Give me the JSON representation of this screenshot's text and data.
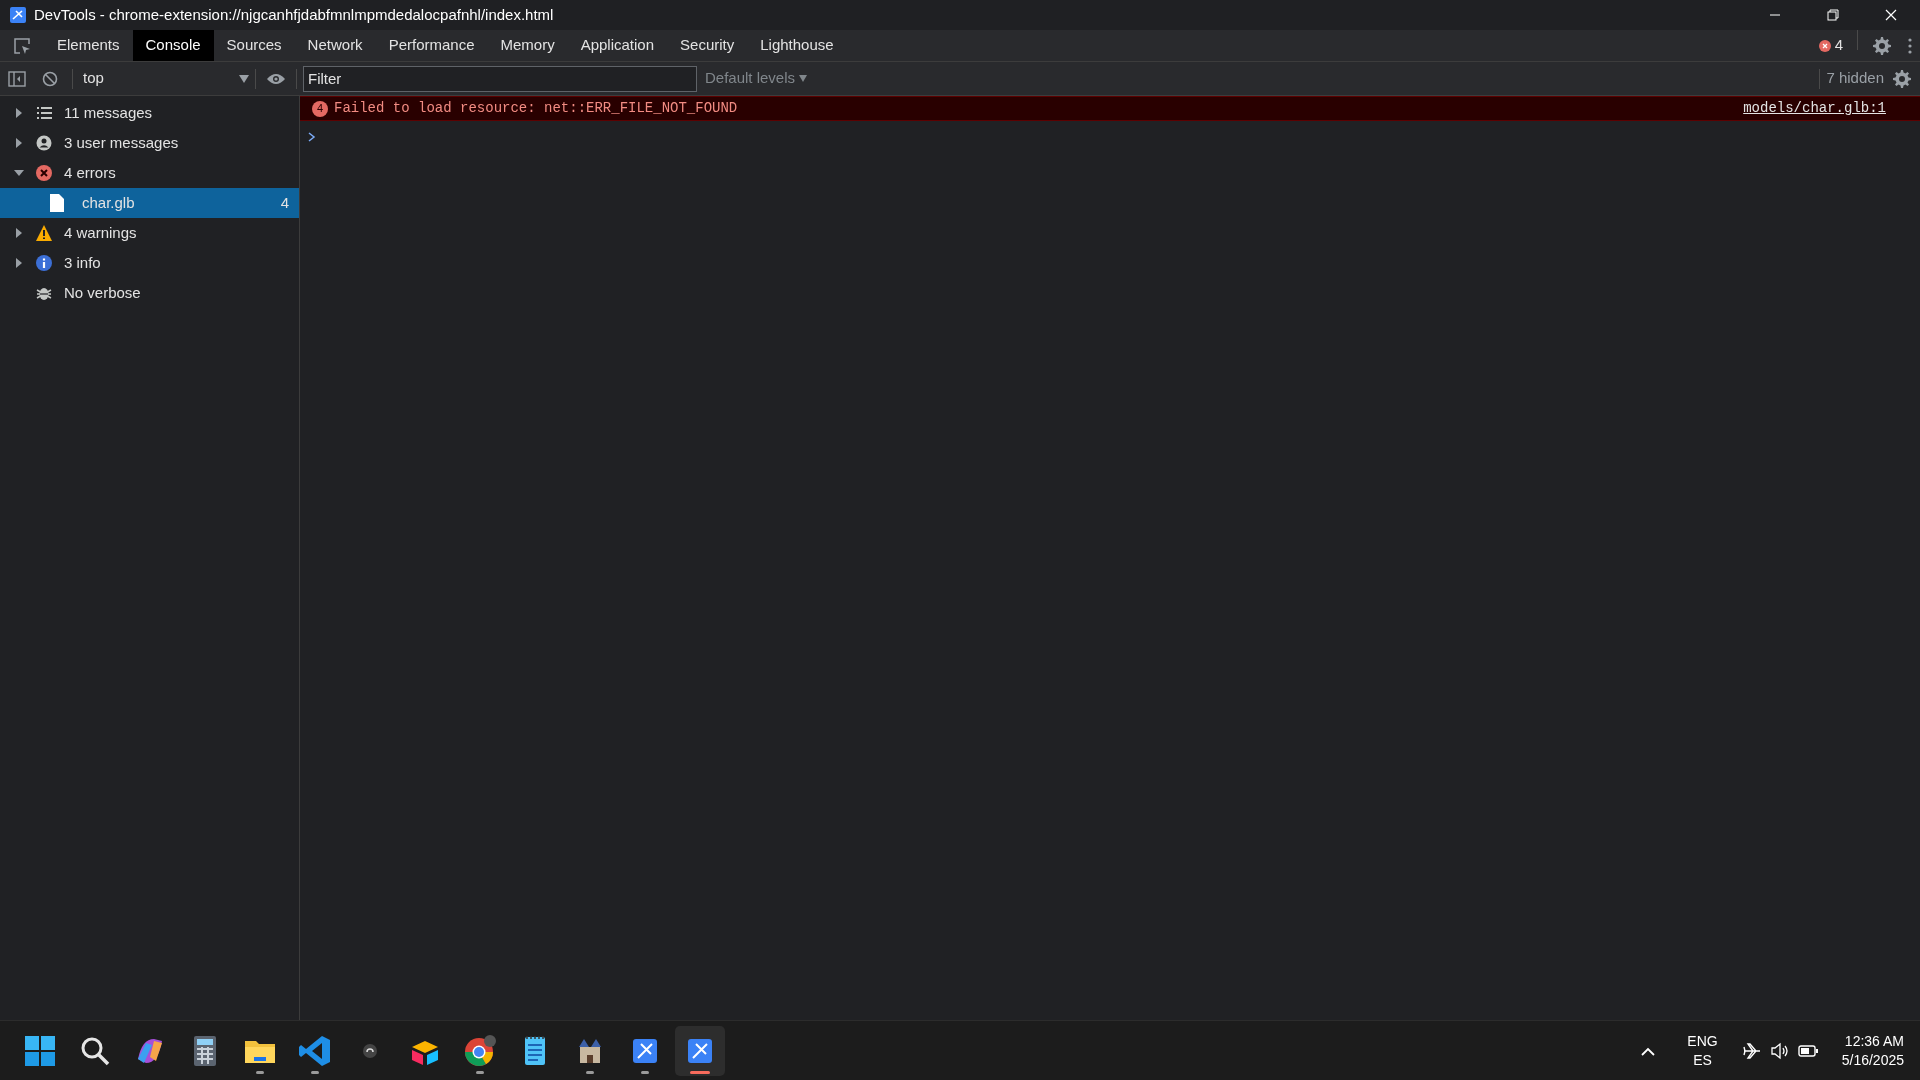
{
  "window": {
    "title": "DevTools - chrome-extension://njgcanhfjdabfmnlmpmdedalocpafnhl/index.html"
  },
  "tabs": [
    {
      "label": "Elements",
      "selected": false
    },
    {
      "label": "Console",
      "selected": true
    },
    {
      "label": "Sources",
      "selected": false
    },
    {
      "label": "Network",
      "selected": false
    },
    {
      "label": "Performance",
      "selected": false
    },
    {
      "label": "Memory",
      "selected": false
    },
    {
      "label": "Application",
      "selected": false
    },
    {
      "label": "Security",
      "selected": false
    },
    {
      "label": "Lighthouse",
      "selected": false
    }
  ],
  "error_count": "4",
  "toolbar": {
    "context": "top",
    "filter": {
      "placeholder": "Filter"
    },
    "levels": "Default levels",
    "hidden": "7 hidden"
  },
  "sidebar": {
    "items": [
      {
        "kind": "messages",
        "label": "11 messages",
        "expanded": false
      },
      {
        "kind": "user",
        "label": "3 user messages",
        "expanded": false
      },
      {
        "kind": "error",
        "label": "4 errors",
        "expanded": true,
        "children": [
          {
            "label": "char.glb",
            "count": "4",
            "selected": true
          }
        ]
      },
      {
        "kind": "warning",
        "label": "4 warnings",
        "expanded": false
      },
      {
        "kind": "info",
        "label": "3 info",
        "expanded": false
      },
      {
        "kind": "verbose",
        "label": "No verbose"
      }
    ]
  },
  "console": {
    "messages": [
      {
        "kind": "error",
        "count": "4",
        "text": "Failed to load resource: net::ERR_FILE_NOT_FOUND",
        "source": "models/char.glb:1"
      }
    ]
  },
  "taskbar": {
    "apps": [
      {
        "kind": "start",
        "running": false,
        "active": false
      },
      {
        "kind": "search",
        "running": false,
        "active": false
      },
      {
        "kind": "copilot",
        "running": false,
        "active": false
      },
      {
        "kind": "calculator",
        "running": false,
        "active": false
      },
      {
        "kind": "folder",
        "running": true,
        "active": false
      },
      {
        "kind": "code",
        "running": true,
        "active": false
      },
      {
        "kind": "small",
        "running": false,
        "active": false
      },
      {
        "kind": "boxes",
        "running": false,
        "active": false
      },
      {
        "kind": "chrome",
        "running": true,
        "active": false
      },
      {
        "kind": "notepad",
        "running": false,
        "active": false
      },
      {
        "kind": "castle",
        "running": true,
        "active": false
      },
      {
        "kind": "devtools",
        "running": true,
        "active": false
      },
      {
        "kind": "devtools",
        "running": true,
        "active": true
      }
    ],
    "language": "ENG",
    "layout": "ES",
    "time": "12:36 AM",
    "date": "5/16/2025"
  }
}
